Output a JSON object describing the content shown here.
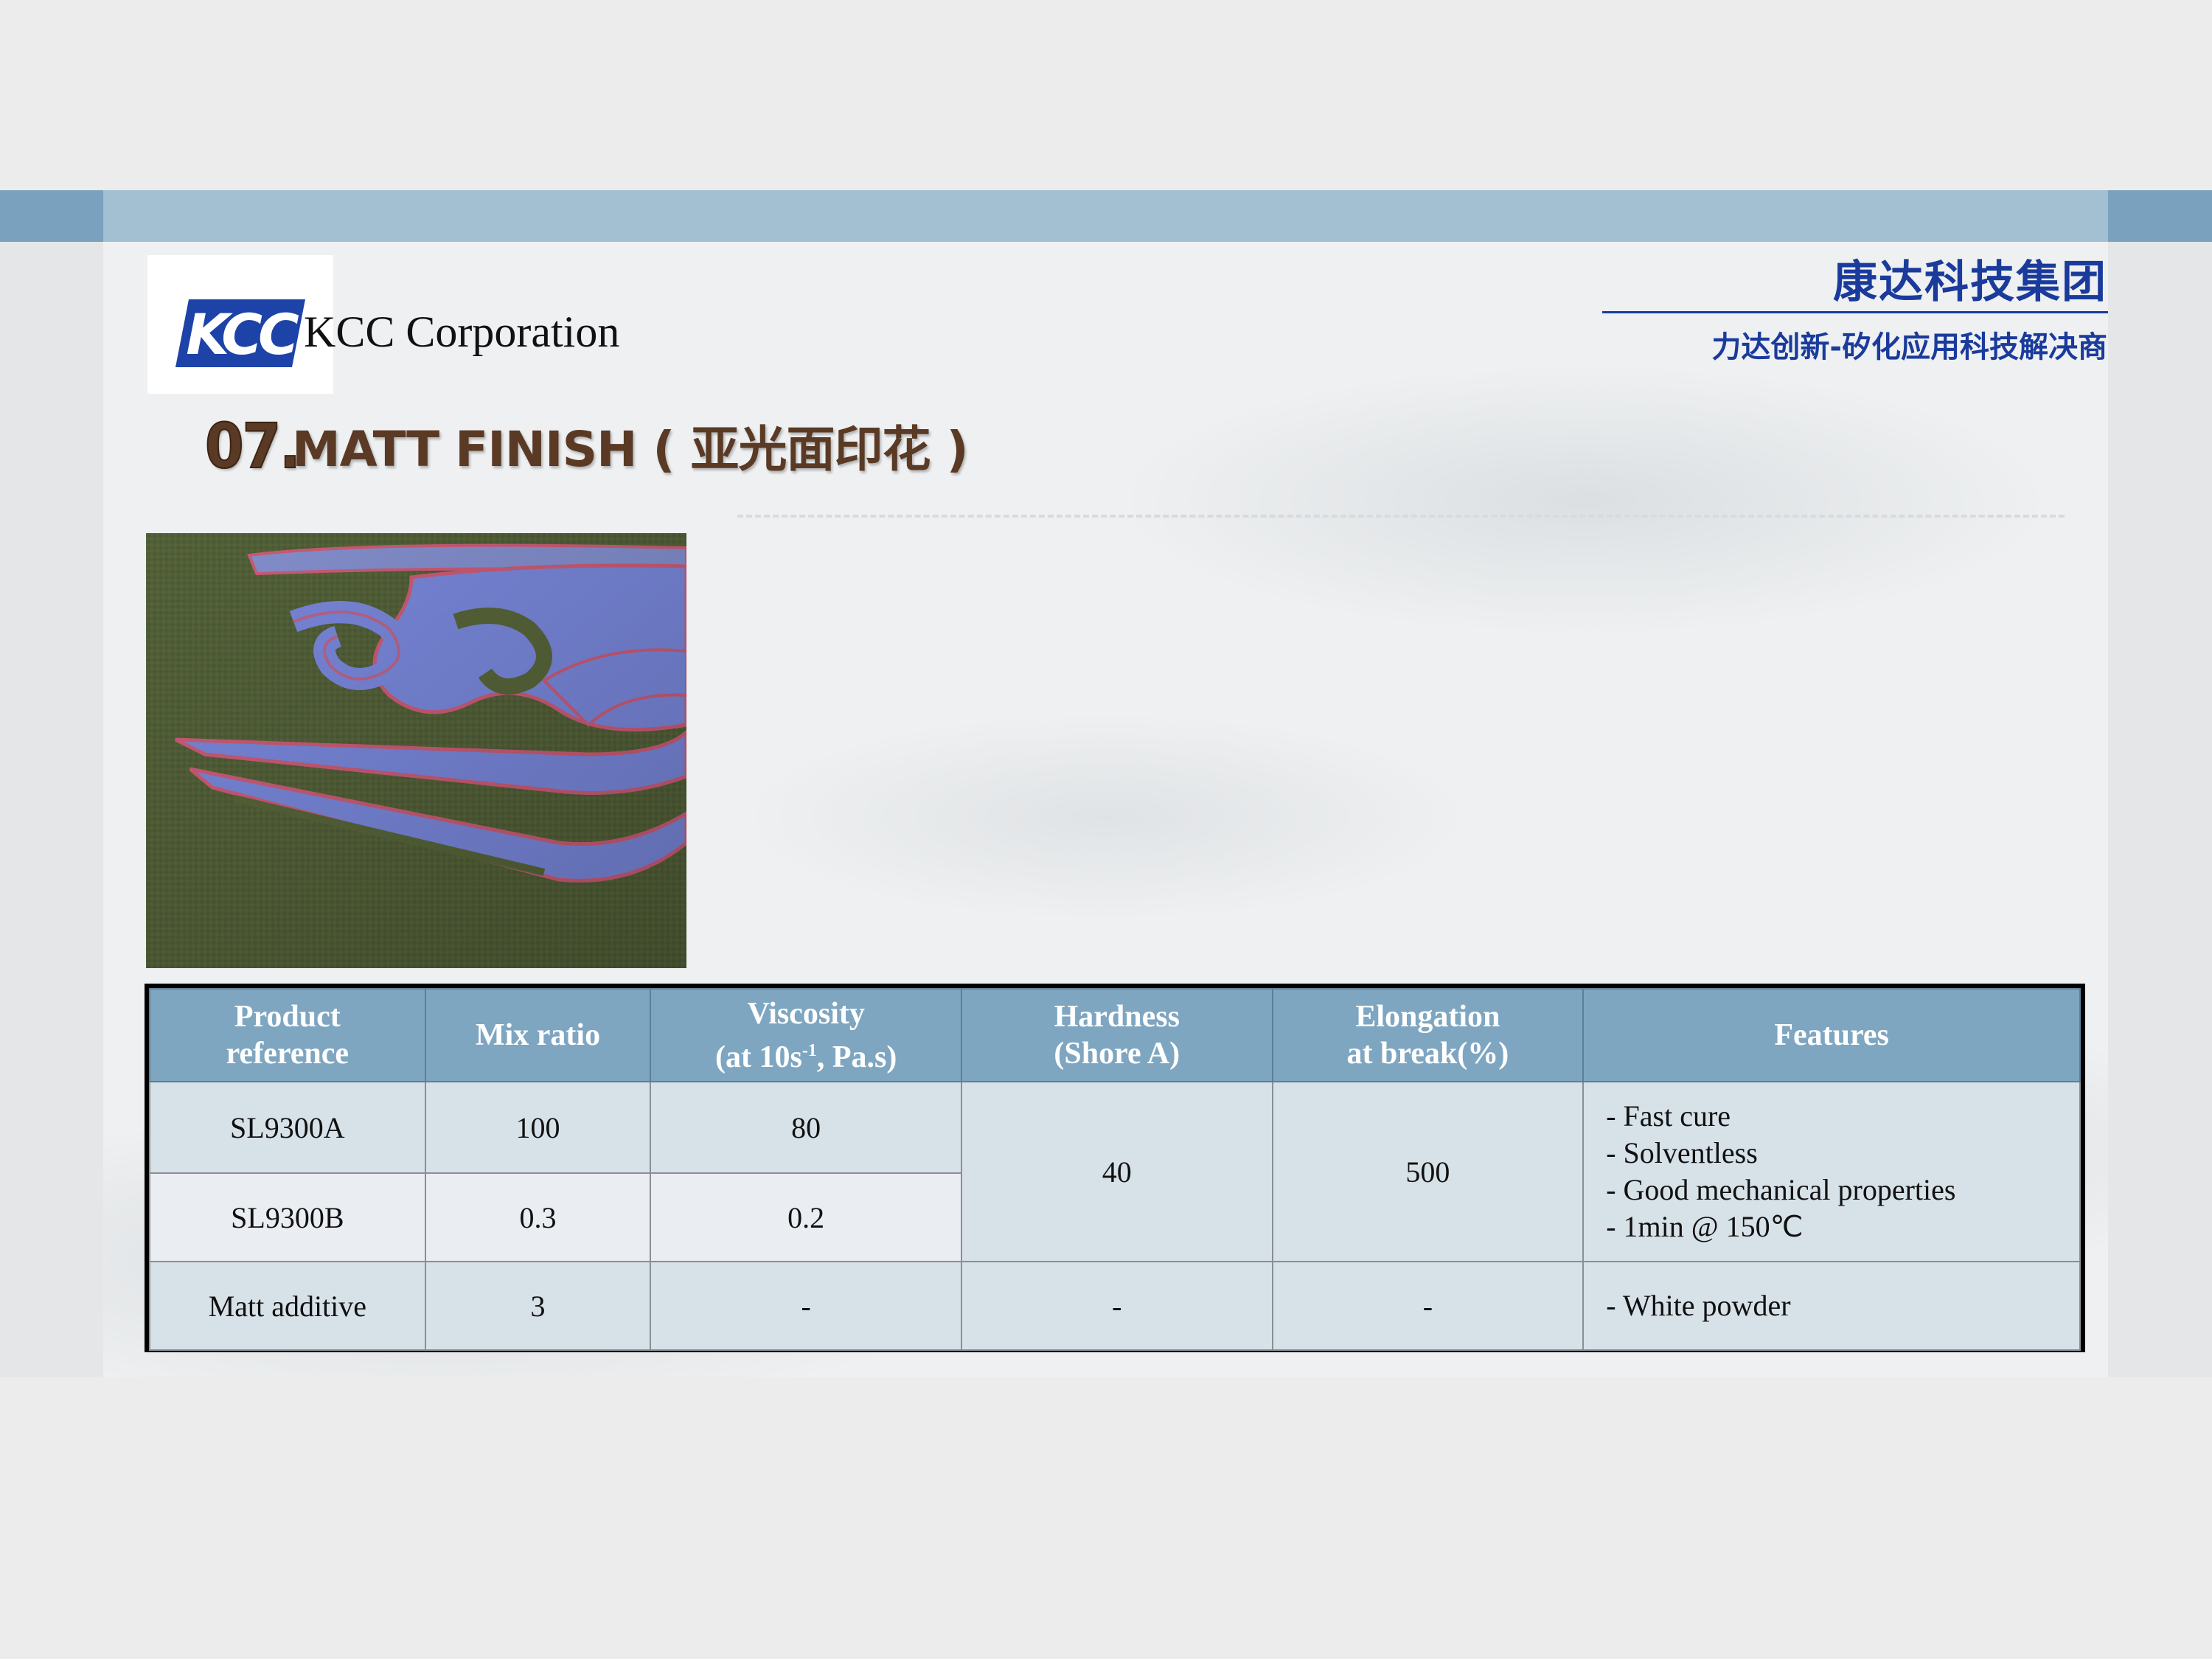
{
  "header": {
    "logo_text": "KCC",
    "company_name": "KCC Corporation",
    "cn_title": "康达科技集团",
    "cn_subtitle": "力达创新-矽化应用科技解决商"
  },
  "section": {
    "number": "07.",
    "title": "MATT FINISH ( 亚光面印花 )"
  },
  "table": {
    "headers": {
      "product_l1": "Product",
      "product_l2": "reference",
      "mix": "Mix ratio",
      "visc_l1": "Viscosity",
      "visc_l2_pre": "(at 10s",
      "visc_sup": "-1",
      "visc_l2_post": ", Pa.s)",
      "hard_l1": "Hardness",
      "hard_l2": "(Shore A)",
      "elong_l1": "Elongation",
      "elong_l2": "at break(%)",
      "features": "Features"
    },
    "rows": [
      {
        "product": "SL9300A",
        "mix": "100",
        "viscosity": "80"
      },
      {
        "product": "SL9300B",
        "mix": "0.3",
        "viscosity": "0.2"
      },
      {
        "product": "Matt additive",
        "mix": "3",
        "viscosity": "-",
        "hardness": "-",
        "elongation": "-",
        "features": "- White powder"
      }
    ],
    "merged": {
      "hardness": "40",
      "elongation": "500",
      "features": [
        "- Fast cure",
        "- Solventless",
        "- Good mechanical properties",
        "-  1min @ 150℃"
      ]
    }
  }
}
